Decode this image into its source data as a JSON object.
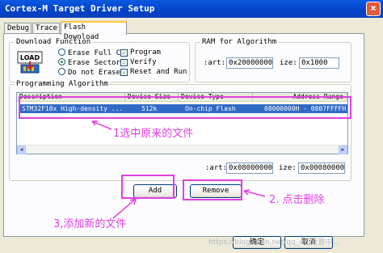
{
  "window": {
    "title": "Cortex-M Target Driver Setup",
    "close_glyph": "×"
  },
  "tabs": [
    {
      "label": "Debug"
    },
    {
      "label": "Trace"
    },
    {
      "label": "Flash Download"
    }
  ],
  "download_function": {
    "title": "Download Function",
    "logo_text": "LOAD",
    "erase_options": [
      {
        "label": "Erase Full C",
        "selected": false
      },
      {
        "label": "Erase Sector",
        "selected": true
      },
      {
        "label": "Do not Erase",
        "selected": false
      }
    ],
    "checks": [
      {
        "label": "Program",
        "checked": true
      },
      {
        "label": "Verify",
        "checked": true
      },
      {
        "label": "Reset and Run",
        "checked": true
      }
    ],
    "check_glyph": "✓"
  },
  "ram": {
    "title": "RAM for Algorithm",
    "start_label": ":art:",
    "start_value": "0x20000000",
    "size_label": "ize:",
    "size_value": "0x1000"
  },
  "algorithm": {
    "title": "Programming Algorithm",
    "columns": [
      "Description",
      "Device Size",
      "Device Type",
      "Address Range"
    ],
    "rows": [
      {
        "description": "STM32F10x High-density ...",
        "size": "512k",
        "type": "On-chip Flash",
        "range": "08000000H - 0807FFFFH"
      }
    ],
    "start_label": ":art:",
    "start_value": "0x08000000",
    "size_label": "ize:",
    "size_value": "0x00080000",
    "scroll_left": "◀",
    "scroll_right": "▶"
  },
  "buttons": {
    "add": "Add",
    "remove": "Remove",
    "ok": "确定",
    "cancel": "取消"
  },
  "annotations": {
    "select_original": "1选中原来的文件",
    "click_delete": "2. 点击删除",
    "add_new": "3,添加新的文件",
    "color": "#e040e0"
  },
  "watermark": "https://blog.csdn.net/qq_4...设置中..."
}
